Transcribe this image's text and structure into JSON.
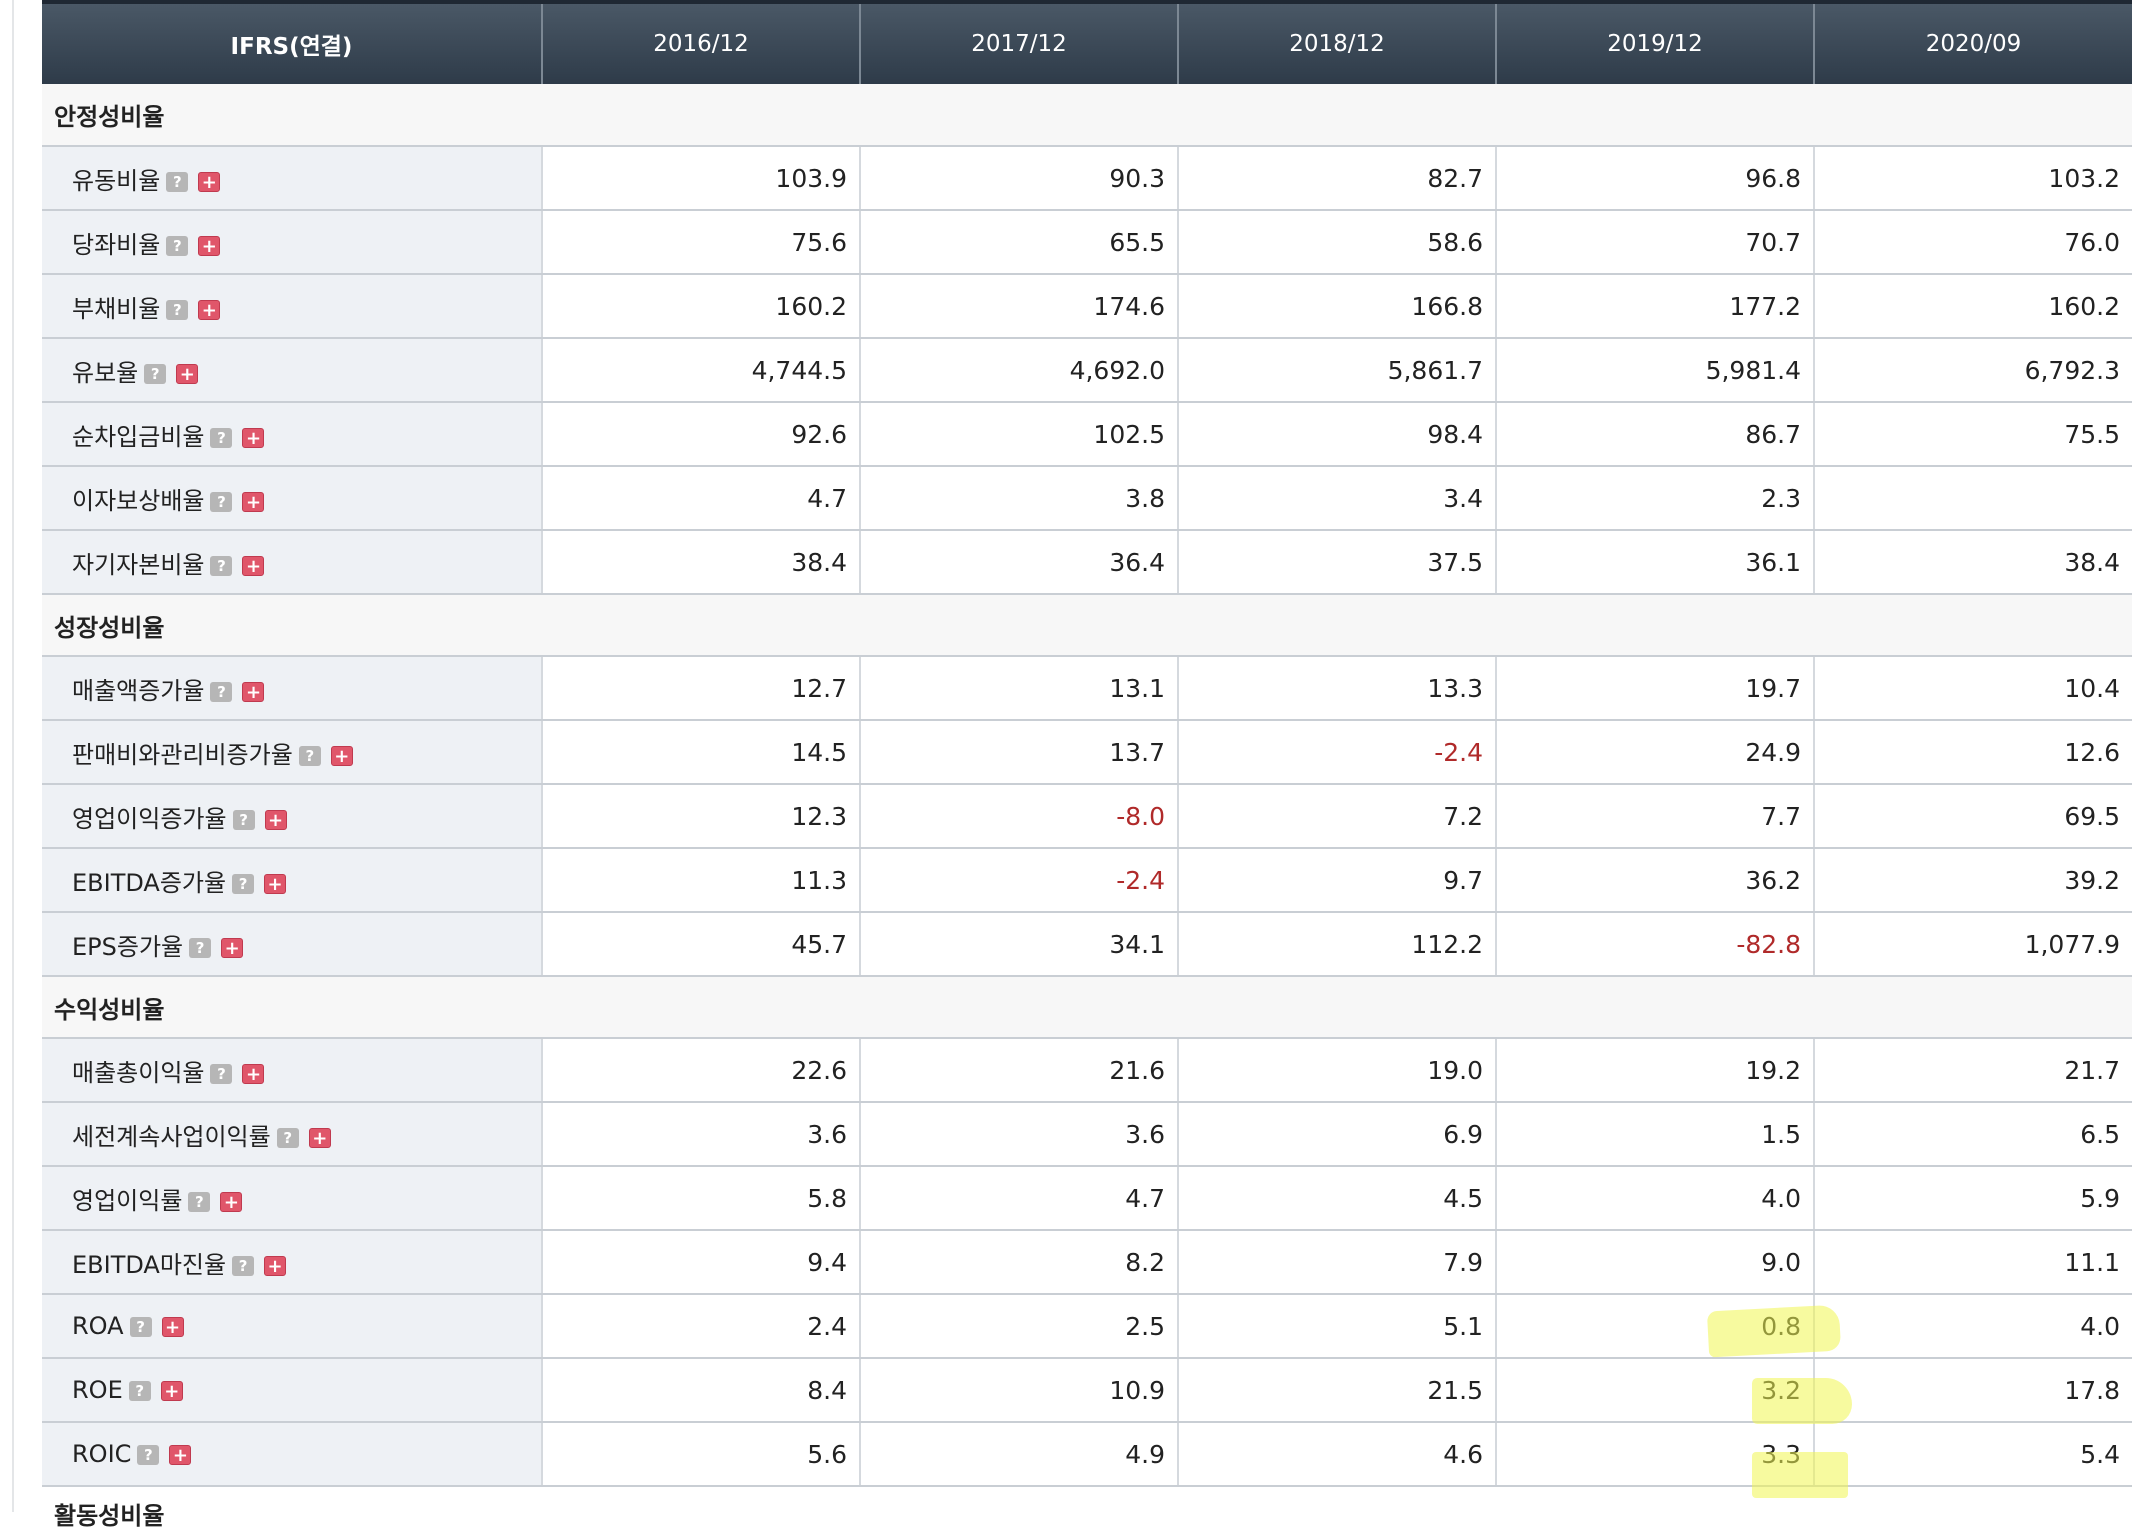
{
  "header": {
    "label": "IFRS(연결)",
    "periods": [
      "2016/12",
      "2017/12",
      "2018/12",
      "2019/12",
      "2020/09"
    ]
  },
  "icons": {
    "help": "question-icon",
    "expand": "plus-icon",
    "help_glyph": "?",
    "expand_glyph": "+"
  },
  "colors": {
    "header_bg": "#2e3b49",
    "negative": "#b02a2a",
    "label_bg": "#eef1f5",
    "highlight": "#f0f550"
  },
  "sections": [
    {
      "title": "안정성비율",
      "rows": [
        {
          "label": "유동비율",
          "values": [
            "103.9",
            "90.3",
            "82.7",
            "96.8",
            "103.2"
          ]
        },
        {
          "label": "당좌비율",
          "values": [
            "75.6",
            "65.5",
            "58.6",
            "70.7",
            "76.0"
          ]
        },
        {
          "label": "부채비율",
          "values": [
            "160.2",
            "174.6",
            "166.8",
            "177.2",
            "160.2"
          ]
        },
        {
          "label": "유보율",
          "values": [
            "4,744.5",
            "4,692.0",
            "5,861.7",
            "5,981.4",
            "6,792.3"
          ]
        },
        {
          "label": "순차입금비율",
          "values": [
            "92.6",
            "102.5",
            "98.4",
            "86.7",
            "75.5"
          ]
        },
        {
          "label": "이자보상배율",
          "values": [
            "4.7",
            "3.8",
            "3.4",
            "2.3",
            ""
          ]
        },
        {
          "label": "자기자본비율",
          "values": [
            "38.4",
            "36.4",
            "37.5",
            "36.1",
            "38.4"
          ]
        }
      ]
    },
    {
      "title": "성장성비율",
      "rows": [
        {
          "label": "매출액증가율",
          "values": [
            "12.7",
            "13.1",
            "13.3",
            "19.7",
            "10.4"
          ]
        },
        {
          "label": "판매비와관리비증가율",
          "values": [
            "14.5",
            "13.7",
            "-2.4",
            "24.9",
            "12.6"
          ]
        },
        {
          "label": "영업이익증가율",
          "values": [
            "12.3",
            "-8.0",
            "7.2",
            "7.7",
            "69.5"
          ]
        },
        {
          "label": "EBITDA증가율",
          "values": [
            "11.3",
            "-2.4",
            "9.7",
            "36.2",
            "39.2"
          ]
        },
        {
          "label": "EPS증가율",
          "values": [
            "45.7",
            "34.1",
            "112.2",
            "-82.8",
            "1,077.9"
          ]
        }
      ]
    },
    {
      "title": "수익성비율",
      "rows": [
        {
          "label": "매출총이익율",
          "values": [
            "22.6",
            "21.6",
            "19.0",
            "19.2",
            "21.7"
          ]
        },
        {
          "label": "세전계속사업이익률",
          "values": [
            "3.6",
            "3.6",
            "6.9",
            "1.5",
            "6.5"
          ]
        },
        {
          "label": "영업이익률",
          "values": [
            "5.8",
            "4.7",
            "4.5",
            "4.0",
            "5.9"
          ]
        },
        {
          "label": "EBITDA마진율",
          "values": [
            "9.4",
            "8.2",
            "7.9",
            "9.0",
            "11.1"
          ]
        },
        {
          "label": "ROA",
          "values": [
            "2.4",
            "2.5",
            "5.1",
            "0.8",
            "4.0"
          ]
        },
        {
          "label": "ROE",
          "values": [
            "8.4",
            "10.9",
            "21.5",
            "3.2",
            "17.8"
          ]
        },
        {
          "label": "ROIC",
          "values": [
            "5.6",
            "4.9",
            "4.6",
            "3.3",
            "5.4"
          ]
        }
      ]
    }
  ],
  "next_section_partial": "활동성비율"
}
